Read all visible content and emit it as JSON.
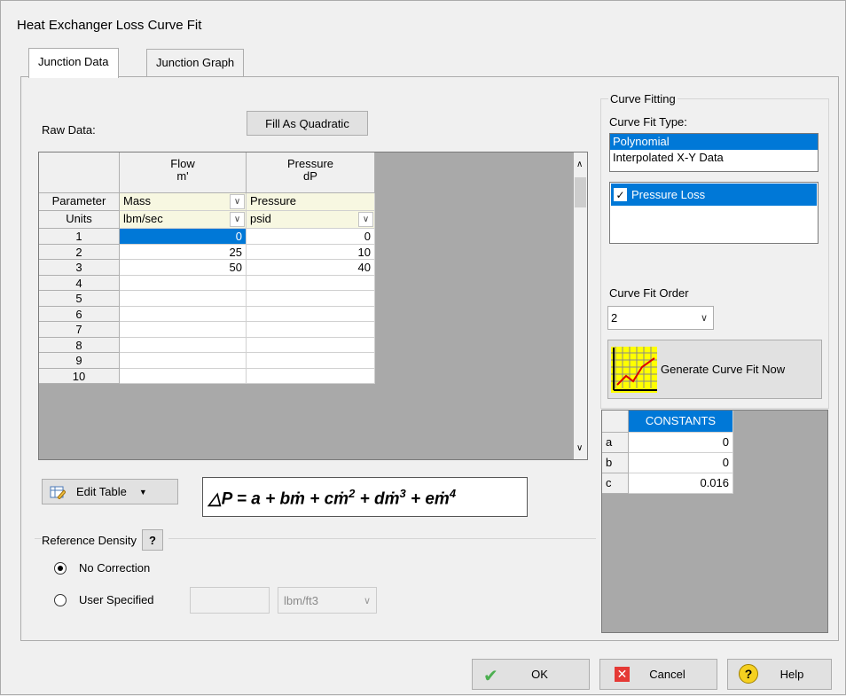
{
  "window": {
    "title": "Heat Exchanger Loss Curve Fit"
  },
  "tabs": [
    {
      "label": "Junction Data",
      "active": true
    },
    {
      "label": "Junction Graph",
      "active": false
    }
  ],
  "raw_data": {
    "label": "Raw Data:",
    "fill_button": "Fill As Quadratic",
    "columns": [
      {
        "name": "Flow",
        "symbol": "m'",
        "parameter": "Mass",
        "units": "lbm/sec"
      },
      {
        "name": "Pressure",
        "symbol": "dP",
        "parameter": "Pressure",
        "units": "psid"
      }
    ],
    "row_labels": {
      "parameter": "Parameter",
      "units": "Units"
    },
    "rows": [
      {
        "index": "1",
        "flow": "0",
        "pressure": "0"
      },
      {
        "index": "2",
        "flow": "25",
        "pressure": "10"
      },
      {
        "index": "3",
        "flow": "50",
        "pressure": "40"
      },
      {
        "index": "4",
        "flow": "",
        "pressure": ""
      },
      {
        "index": "5",
        "flow": "",
        "pressure": ""
      },
      {
        "index": "6",
        "flow": "",
        "pressure": ""
      },
      {
        "index": "7",
        "flow": "",
        "pressure": ""
      },
      {
        "index": "8",
        "flow": "",
        "pressure": ""
      },
      {
        "index": "9",
        "flow": "",
        "pressure": ""
      },
      {
        "index": "10",
        "flow": "",
        "pressure": ""
      }
    ]
  },
  "edit_table": {
    "label": "Edit Table"
  },
  "formula": {
    "prefix": "△P = a + bṁ + cṁ",
    "p2": "2",
    "mid1": " + dṁ",
    "p3": "3",
    "mid2": " + eṁ",
    "p4": "4"
  },
  "reference_density": {
    "label": "Reference Density",
    "help": "?",
    "no_correction": "No Correction",
    "user_specified": "User Specified",
    "user_value": "",
    "units": "lbm/ft3",
    "selected": "no_correction"
  },
  "curve_fitting": {
    "group_label": "Curve Fitting",
    "type_label": "Curve Fit Type:",
    "types": [
      "Polynomial",
      "Interpolated X-Y Data"
    ],
    "selected_type": "Polynomial",
    "checklist": [
      {
        "label": "Pressure Loss",
        "checked": true
      }
    ],
    "order_label": "Curve Fit Order",
    "order_value": "2",
    "generate_button": "Generate Curve Fit Now"
  },
  "constants": {
    "header": "CONSTANTS",
    "rows": [
      {
        "name": "a",
        "value": "0"
      },
      {
        "name": "b",
        "value": "0"
      },
      {
        "name": "c",
        "value": "0.016"
      }
    ]
  },
  "footer": {
    "ok": "OK",
    "cancel": "Cancel",
    "help": "Help"
  },
  "colors": {
    "selection": "#0078d7",
    "param_row": "#f7f7e1",
    "grid_bg": "#a9a9a9",
    "ok_check": "#4caf50",
    "cancel_x": "#e53935"
  }
}
